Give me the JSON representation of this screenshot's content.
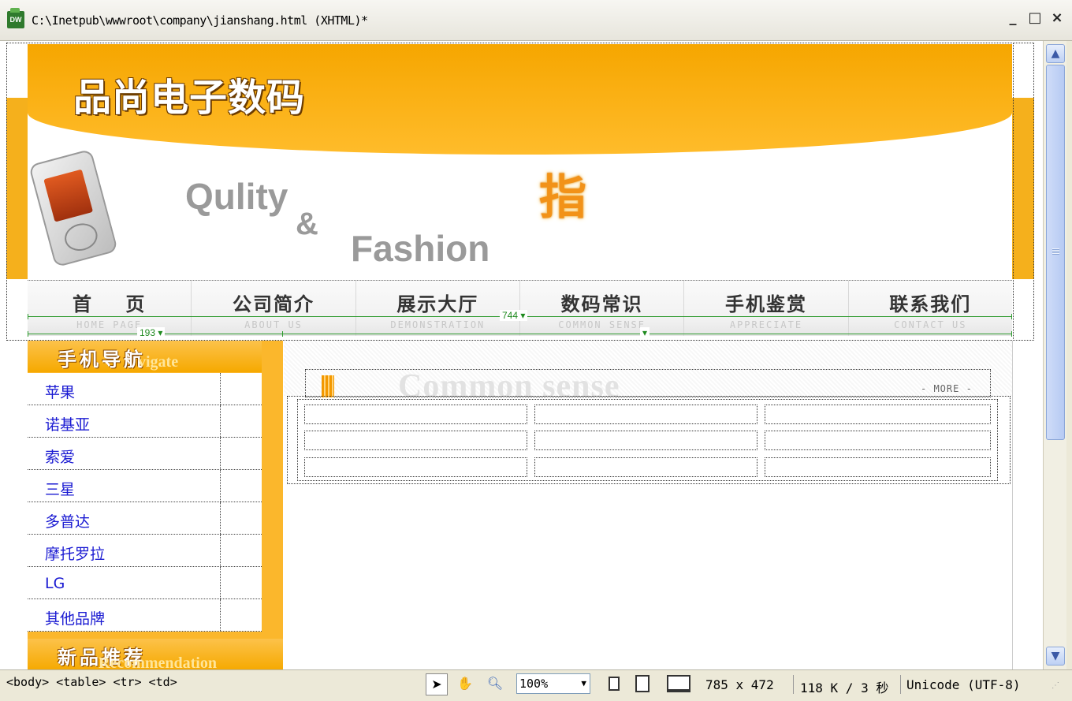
{
  "window": {
    "app_icon": "DW",
    "title": "C:\\Inetpub\\wwwroot\\company\\jianshang.html (XHTML)*",
    "minimize": "_",
    "maximize": "□",
    "close": "×"
  },
  "banner": {
    "brand": "品尚电子数码",
    "slogan_1": "Qulity",
    "slogan_amp": "&",
    "slogan_2": "Fashion",
    "accent_char": "指"
  },
  "nav": [
    {
      "cn": "首    页",
      "en": "HOME PAGE"
    },
    {
      "cn": "公司简介",
      "en": "ABOUT US"
    },
    {
      "cn": "展示大厅",
      "en": "DEMONSTRATION"
    },
    {
      "cn": "数码常识",
      "en": "COMMON SENSE"
    },
    {
      "cn": "手机鉴赏",
      "en": "APPRECIATE"
    },
    {
      "cn": "联系我们",
      "en": "CONTACT US"
    }
  ],
  "guides": {
    "table_width": "744",
    "column_width": "193"
  },
  "sidebar": {
    "nav_heading_cn": "手机导航",
    "nav_heading_en": "vigate",
    "brands": [
      "苹果",
      "诺基亚",
      "索爱",
      "三星",
      "多普达",
      "摩托罗拉",
      "LG",
      "其他品牌"
    ],
    "new_heading_cn": "新品推荐",
    "new_heading_en": "Recommendation"
  },
  "content": {
    "watermark": "Common sense",
    "more_label": "- MORE -"
  },
  "statusbar": {
    "tag_selector": "<body> <table> <tr> <td>",
    "zoom": "100%",
    "dimensions": "785 x 472",
    "download": "118 K / 3 秒",
    "encoding": "Unicode (UTF-8)"
  },
  "colors": {
    "accent_orange": "#f6a600",
    "link_blue": "#1a1ad2",
    "guide_green": "#2f9b2f"
  }
}
